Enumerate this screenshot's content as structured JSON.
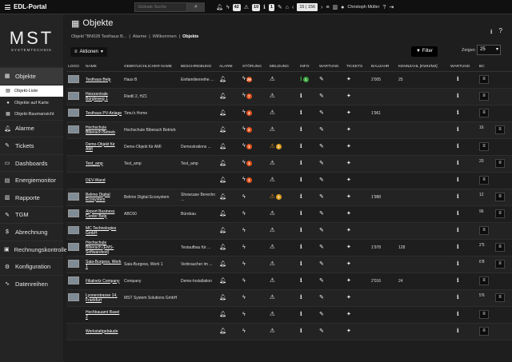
{
  "topbar": {
    "title": "EDL-Portal",
    "search_placeholder": "Globale Suche",
    "counts": [
      "42",
      "10",
      "1"
    ],
    "pager": "15 | 156",
    "user": "Christoph Müller"
  },
  "logo": {
    "main": "MST",
    "sub": "SYSTEMTECHNIK"
  },
  "nav": {
    "objekte": "Objekte",
    "subs": [
      "Objekt-Liste",
      "Objekte auf Karte",
      "Objekt-Baumansicht"
    ],
    "items": [
      "Alarme",
      "Tickets",
      "Dashboards",
      "Energiemonitor",
      "Rapporte",
      "TGM",
      "Abrechnung",
      "Rechnungskontrolle",
      "Konfiguration",
      "Datenreihen"
    ]
  },
  "page": {
    "title": "Objekte",
    "crumbs": [
      "Objekt \"BN028 Testhaus B...",
      "Alarme",
      "Willkommen",
      "Objekte"
    ],
    "actions_label": "Aktionen",
    "filter_label": "Filter",
    "show_label": "Zeigen",
    "show_value": "25"
  },
  "table": {
    "headers": [
      "LOGO",
      "NAME",
      "GEBRÄUCHLICHER NAME",
      "BESCHREIBUNG",
      "ALARM",
      "STÖRUNG",
      "MELDUNG",
      "INFO",
      "WARTUNG",
      "TICKETS",
      "BAUJAHR",
      "KENNZAHL [KWH/M2]",
      "WARTUNG",
      "BC"
    ],
    "rows": [
      {
        "logo": true,
        "name": "Testhaus Belp",
        "common": "Haus B",
        "desc": "Einfamilienreihe ...",
        "stoerung": "28",
        "meldung": "",
        "info": "1",
        "year": "2'005",
        "kennzahl": "25",
        "bc": ""
      },
      {
        "logo": true,
        "name": "Heizzentrale Bürgleweg 1",
        "common": "Riedli 2, HZ1",
        "desc": "",
        "stoerung": "7",
        "meldung": "",
        "info": "",
        "year": "",
        "kennzahl": "",
        "bc": ""
      },
      {
        "logo": true,
        "name": "Testhaus PV-Anlage",
        "common": "Timu's Home",
        "desc": "",
        "stoerung": "4",
        "meldung": "",
        "info": "",
        "year": "1'961",
        "kennzahl": "",
        "bc": ""
      },
      {
        "logo": true,
        "name": "Hochschule Biberach Betrieb",
        "common": "Hochschule Biberach Betrieb",
        "desc": "",
        "stoerung": "2",
        "meldung": "",
        "info": "",
        "year": "",
        "kennzahl": "",
        "bc": "16"
      },
      {
        "logo": false,
        "name": "Demo-Objekt für AMI",
        "common": "Demo-Objekt für AMI",
        "desc": "Demostrations ...",
        "stoerung": "1",
        "meldung": "2",
        "info": "",
        "year": "",
        "kennzahl": "",
        "bc": ""
      },
      {
        "logo": false,
        "name": "Test_amp",
        "common": "Test_amp",
        "desc": "Test_amp",
        "stoerung": "1",
        "meldung": "",
        "info": "",
        "year": "",
        "kennzahl": "",
        "bc": "20"
      },
      {
        "logo": false,
        "name": "DEV-Wand",
        "common": "",
        "desc": "",
        "stoerung": "1",
        "meldung": "",
        "info": "",
        "year": "",
        "kennzahl": "",
        "bc": ""
      },
      {
        "logo": true,
        "name": "Belimo Digital Ecosystem",
        "common": "Belimo Digital Ecosystem",
        "desc": "Showcase Berechn ...",
        "stoerung": "",
        "meldung": "1",
        "info": "",
        "year": "1'988",
        "kennzahl": "",
        "bc": "12"
      },
      {
        "logo": true,
        "name": "Airport Business Center Belp",
        "common": "ABC60",
        "desc": "Bürobau",
        "stoerung": "",
        "meldung": "",
        "info": "",
        "year": "",
        "kennzahl": "",
        "bc": "96"
      },
      {
        "logo": true,
        "name": "MC Technologies GmbH",
        "common": "",
        "desc": "",
        "stoerung": "",
        "meldung": "",
        "info": "",
        "year": "",
        "kennzahl": "",
        "bc": ""
      },
      {
        "logo": true,
        "name": "Hochschule Biberach (EMS-Softwaretest)",
        "common": "",
        "desc": "Testaufbau für ...",
        "stoerung": "",
        "meldung": "",
        "info": "",
        "year": "1'978",
        "kennzahl": "128",
        "bc": "2'5"
      },
      {
        "logo": true,
        "name": "Saia-Burgess, Werk 1",
        "common": "Saia-Burgess, Werk 1",
        "desc": "Verbraucher im ...",
        "stoerung": "",
        "meldung": "",
        "info": "",
        "year": "",
        "kennzahl": "",
        "bc": "6'8"
      },
      {
        "logo": true,
        "name": "Filialnetz Company",
        "common": "Company",
        "desc": "Demo-Installation",
        "stoerung": "",
        "meldung": "",
        "info": "",
        "year": "2'016",
        "kennzahl": "24",
        "bc": ""
      },
      {
        "logo": true,
        "name": "Lyonerstrasse 14, Frankfurt",
        "common": "MST System Solutions GmbH",
        "desc": "",
        "stoerung": "",
        "meldung": "",
        "info": "",
        "year": "",
        "kennzahl": "",
        "bc": "5'6"
      },
      {
        "logo": false,
        "name": "Hochbauamt Basel 2",
        "common": "",
        "desc": "",
        "stoerung": "",
        "meldung": "",
        "info": "",
        "year": "",
        "kennzahl": "",
        "bc": ""
      },
      {
        "logo": false,
        "name": "Werkstattgebäude",
        "common": "",
        "desc": "",
        "stoerung": "",
        "meldung": "",
        "info": "",
        "year": "",
        "kennzahl": "",
        "bc": ""
      }
    ]
  },
  "colors": {
    "badge_orange": "#e2541e",
    "badge_amber": "#e0a020",
    "info_green": "#3aa43a"
  }
}
